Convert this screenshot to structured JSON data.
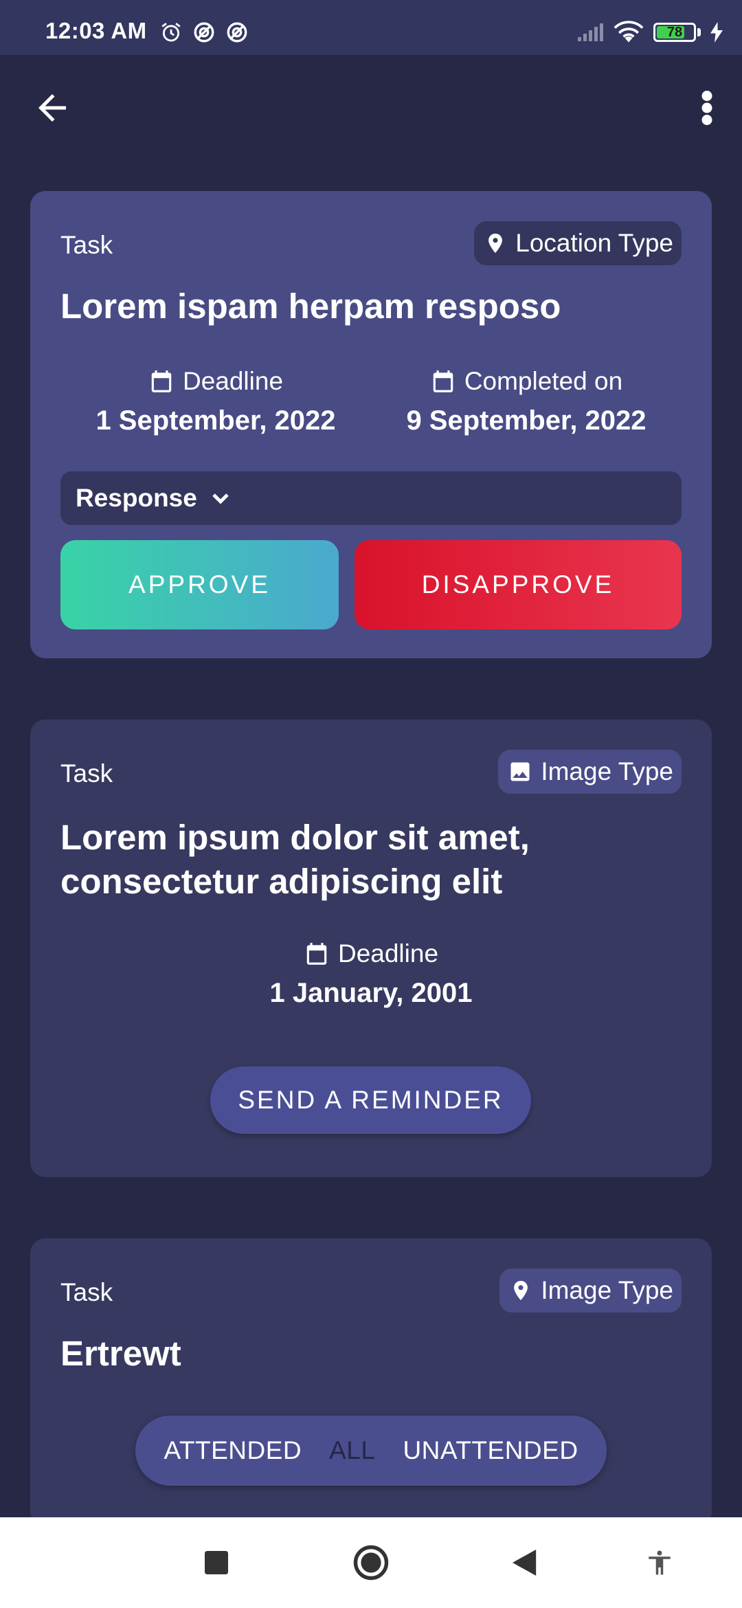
{
  "status_bar": {
    "time": "12:03 AM",
    "battery_level": "78",
    "battery_fraction": 0.78
  },
  "cards": [
    {
      "label": "Task",
      "type": "Location Type",
      "title": "Lorem ispam herpam resposo",
      "deadline_label": "Deadline",
      "deadline": "1 September, 2022",
      "completed_label": "Completed on",
      "completed": "9 September, 2022",
      "response_label": "Response",
      "approve_label": "APPROVE",
      "disapprove_label": "DISAPPROVE"
    },
    {
      "label": "Task",
      "type": "Image Type",
      "title_line1": "Lorem ipsum dolor sit amet,",
      "title_line2": "consectetur adipiscing elit",
      "deadline_label": "Deadline",
      "deadline": "1 January, 2001",
      "reminder_label": "SEND A REMINDER"
    },
    {
      "label": "Task",
      "type": "Image Type",
      "title": "Ertrewt"
    }
  ],
  "filter": {
    "options": [
      "ATTENDED",
      "ALL",
      "UNATTENDED"
    ],
    "selected": "ALL"
  },
  "colors": {
    "background": "#272846",
    "active_card": "#494b84",
    "card": "#373960",
    "approve": "#39d3a6",
    "disapprove": "#d9122b"
  }
}
